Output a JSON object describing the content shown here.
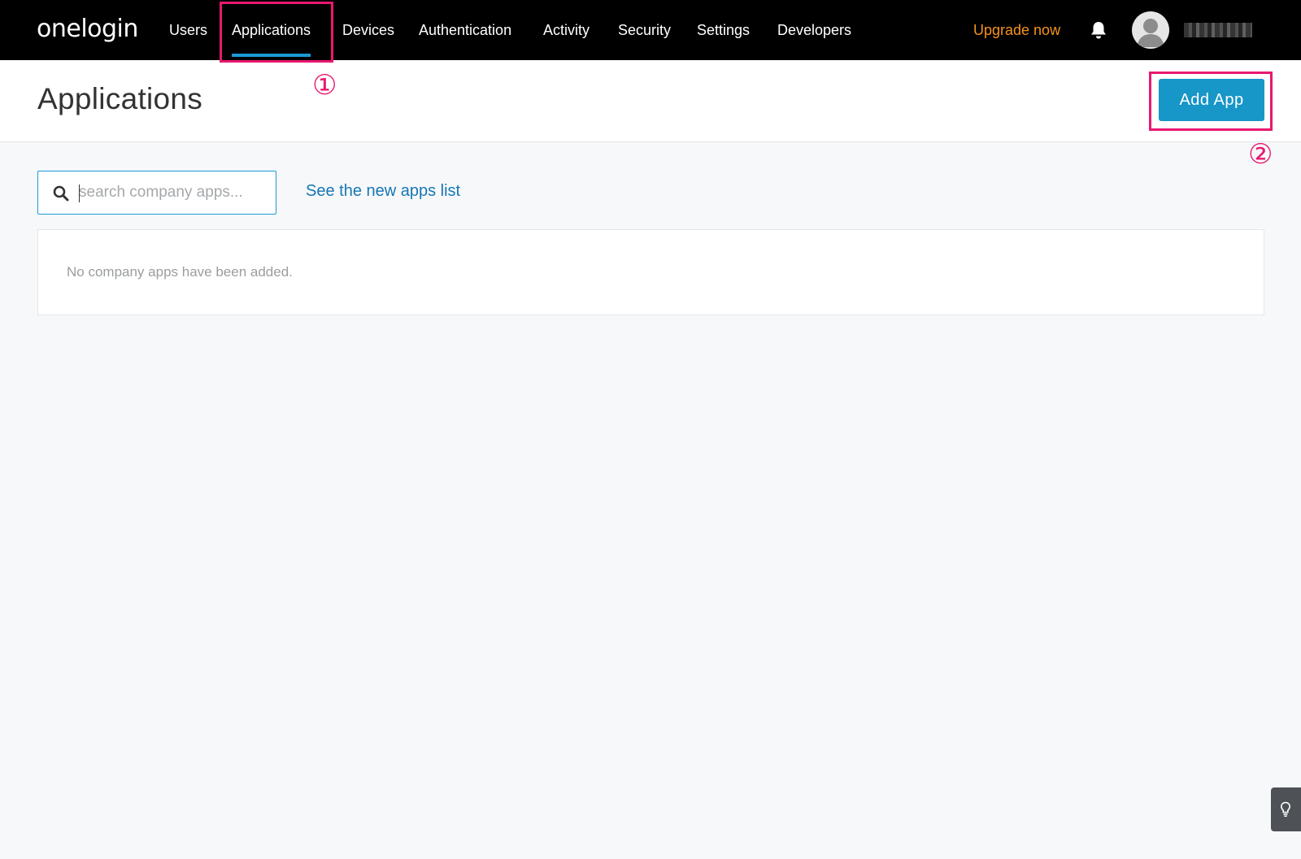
{
  "nav": {
    "logo": "onelogin",
    "items": [
      {
        "label": "Users"
      },
      {
        "label": "Applications",
        "active": true
      },
      {
        "label": "Devices"
      },
      {
        "label": "Authentication"
      },
      {
        "label": "Activity"
      },
      {
        "label": "Security"
      },
      {
        "label": "Settings"
      },
      {
        "label": "Developers"
      }
    ],
    "upgrade": "Upgrade now",
    "bell_icon": "bell-icon",
    "avatar_icon": "user-avatar-icon"
  },
  "header": {
    "title": "Applications",
    "add_button": "Add App"
  },
  "annotations": {
    "step1": "①",
    "step2": "②",
    "color": "#e8186f"
  },
  "search": {
    "placeholder": "search company apps...",
    "value": "",
    "icon": "search-icon"
  },
  "new_apps_link": "See the new apps list",
  "apps": {
    "empty_message": "No company apps have been added."
  },
  "tip_button": {
    "icon": "lightbulb-icon"
  },
  "colors": {
    "accent": "#1796c8",
    "link": "#1577b5",
    "upgrade": "#f7931e",
    "nav_bg": "#000000"
  }
}
